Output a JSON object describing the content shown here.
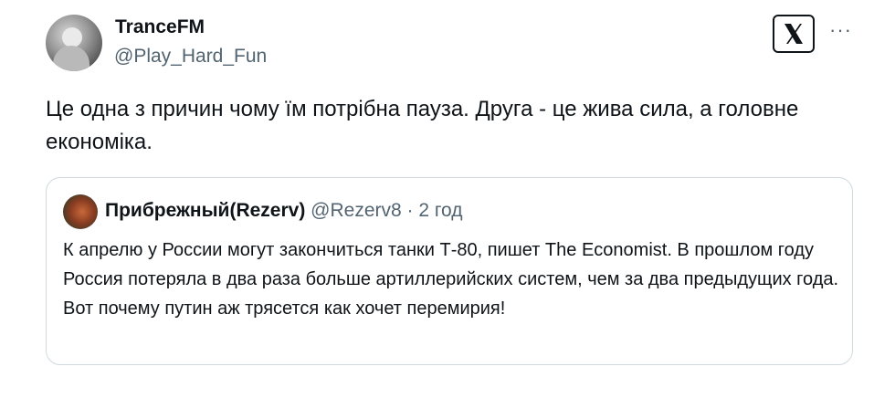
{
  "author": {
    "name": "TranceFM",
    "handle": "@Play_Hard_Fun"
  },
  "tweet": {
    "text": "Це одна з причин чому їм потрібна пауза. Друга - це жива сила, а головне економіка."
  },
  "quoted": {
    "name": "Прибрежный(Rezerv)",
    "handle": "@Rezerv8",
    "separator": " · ",
    "time": "2 год",
    "text": "К апрелю у России могут закончиться танки Т-80, пишет  The Economist. В прошлом году Россия потеряла в два раза больше артиллерийских систем, чем за два предыдущих года. Вот почему путин аж трясется как хочет перемирия!"
  },
  "icons": {
    "more": "more-horizontal-icon",
    "logo": "x-logo-icon"
  }
}
